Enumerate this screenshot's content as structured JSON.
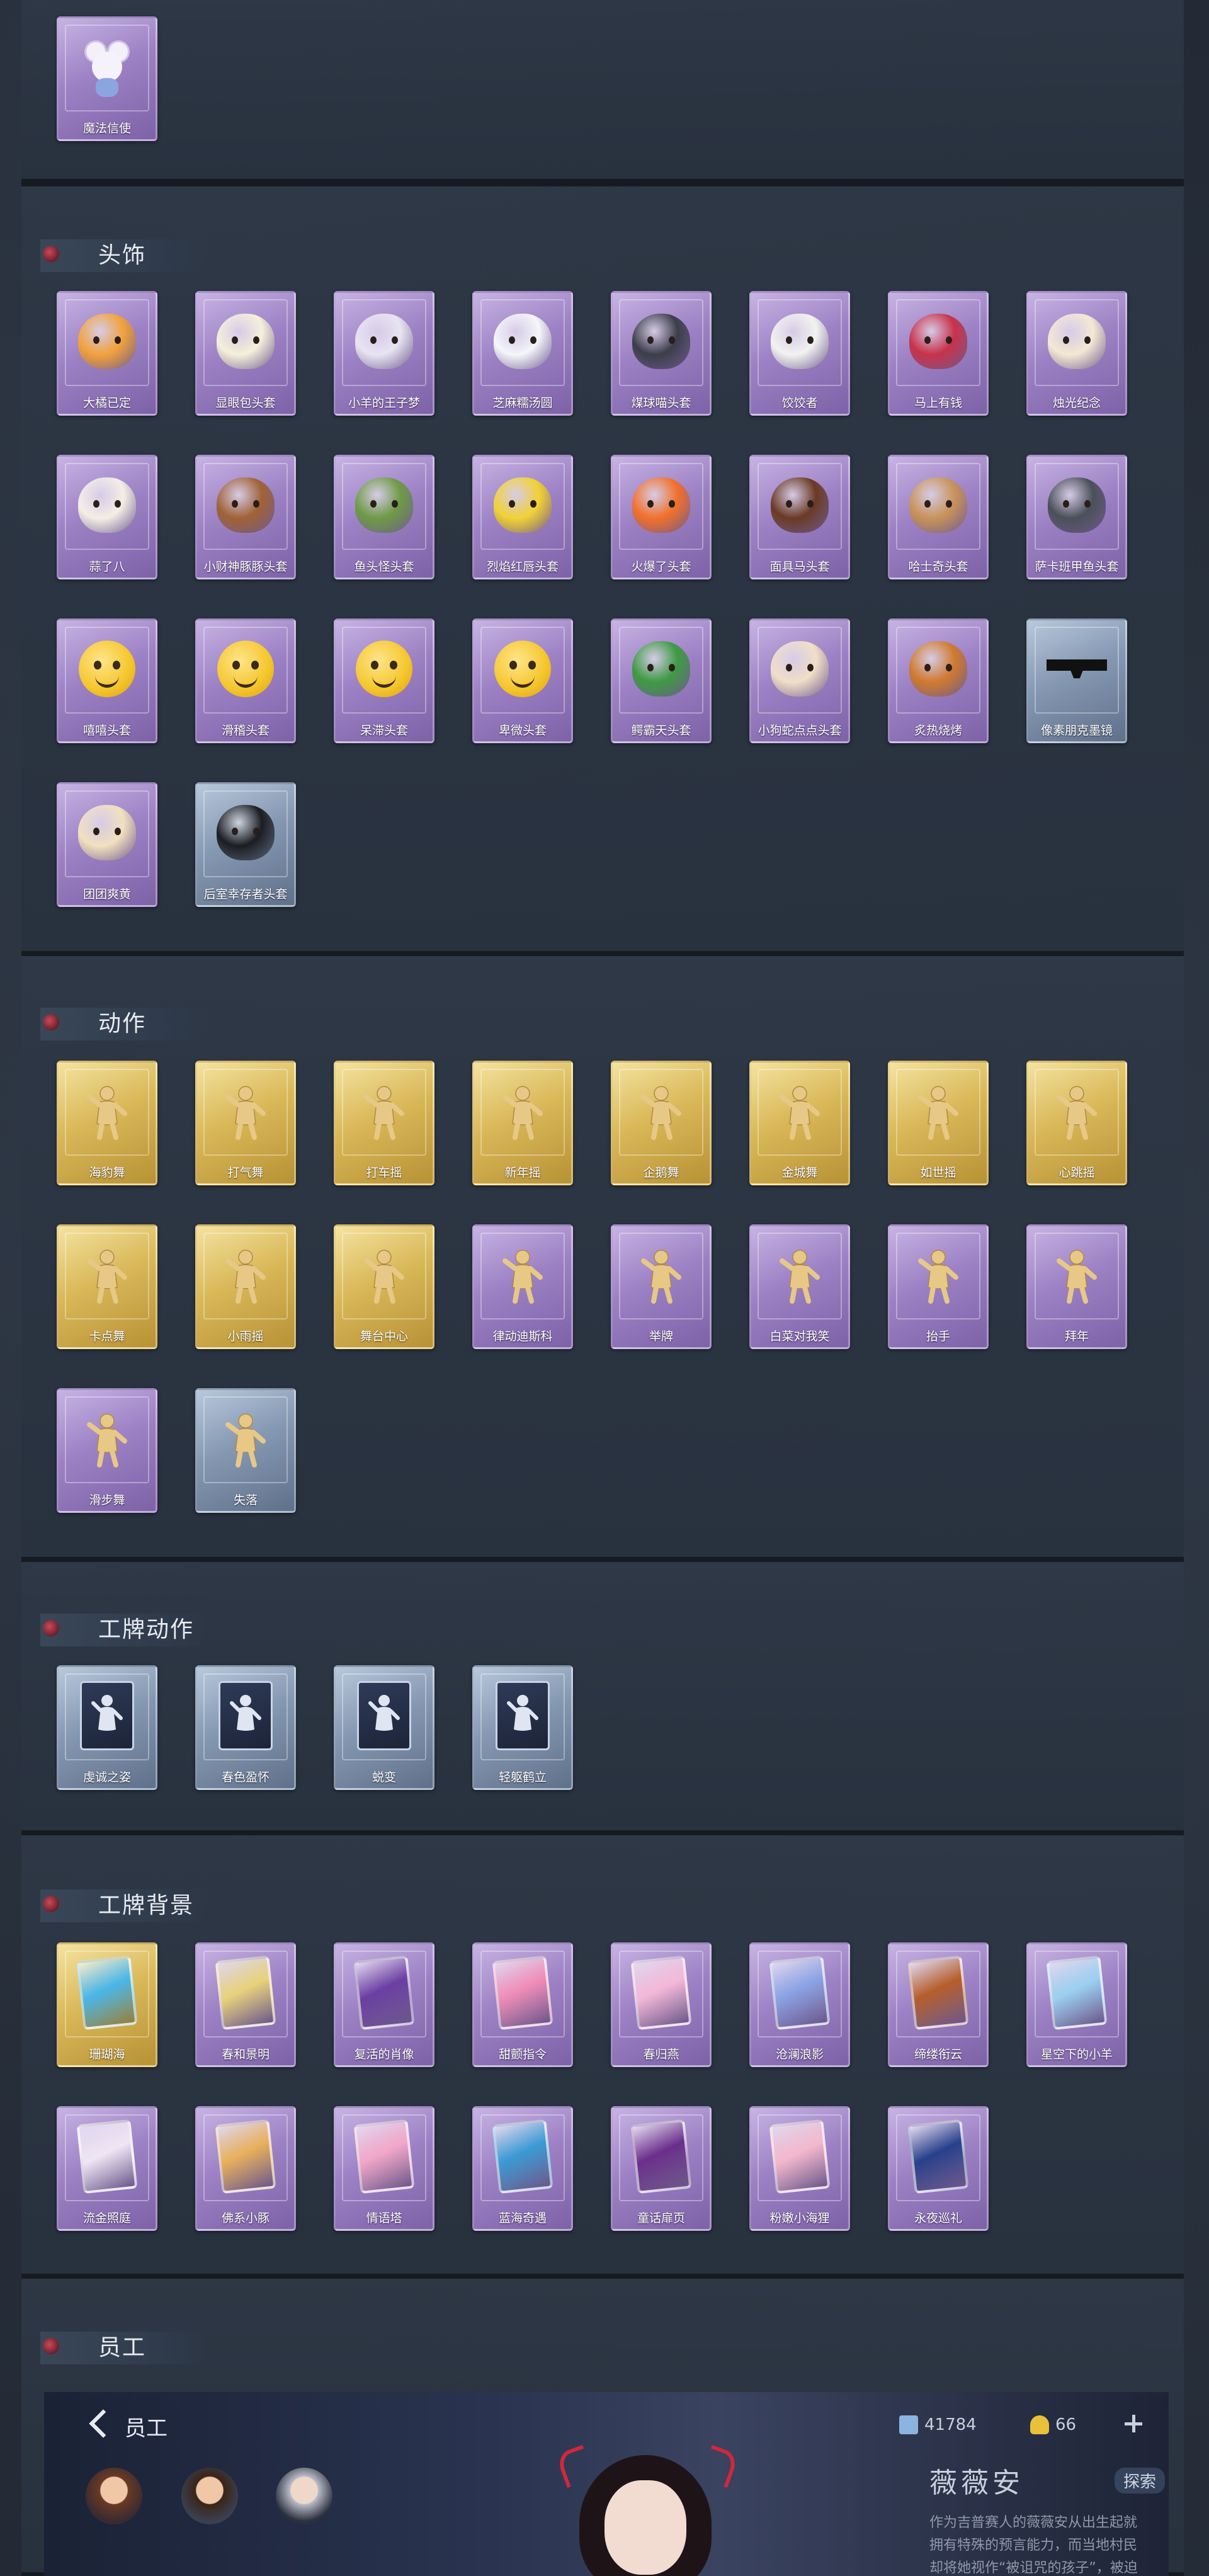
{
  "top_section": {
    "items": [
      {
        "label": "魔法信使",
        "style": "purple",
        "icon": "mouse-mascot-icon"
      }
    ]
  },
  "sections": [
    {
      "title": "头饰",
      "items": [
        {
          "label": "大橘已定",
          "style": "purple",
          "icon": "orange-head-icon",
          "color": "#f2a23c"
        },
        {
          "label": "显眼包头套",
          "style": "purple",
          "icon": "lightbulb-head-icon",
          "color": "#f5f0da"
        },
        {
          "label": "小羊的王子梦",
          "style": "purple",
          "icon": "sheep-crown-head-icon",
          "color": "#e8e4f2"
        },
        {
          "label": "芝麻糯汤圆",
          "style": "purple",
          "icon": "rice-ball-head-icon",
          "color": "#f4f6fa"
        },
        {
          "label": "煤球喵头套",
          "style": "purple",
          "icon": "black-cat-head-icon",
          "color": "#3b3e4a"
        },
        {
          "label": "饺饺者",
          "style": "purple",
          "icon": "dumpling-head-icon",
          "color": "#f1f3f0"
        },
        {
          "label": "马上有钱",
          "style": "purple",
          "icon": "red-horse-head-icon",
          "color": "#c8324a"
        },
        {
          "label": "烛光纪念",
          "style": "purple",
          "icon": "candle-head-icon",
          "color": "#f4e8d4"
        },
        {
          "label": "蒜了八",
          "style": "purple",
          "icon": "garlic-head-icon",
          "color": "#f3efe6"
        },
        {
          "label": "小财神豚豚头套",
          "style": "purple",
          "icon": "piggy-head-icon",
          "color": "#a06236"
        },
        {
          "label": "鱼头怪头套",
          "style": "purple",
          "icon": "fish-head-icon",
          "color": "#6e9a46"
        },
        {
          "label": "烈焰红唇头套",
          "style": "purple",
          "icon": "pikachu-head-icon",
          "color": "#f2d234"
        },
        {
          "label": "火爆了头套",
          "style": "purple",
          "icon": "flame-head-icon",
          "color": "#f2702a"
        },
        {
          "label": "面具马头套",
          "style": "purple",
          "icon": "horse-mask-icon",
          "color": "#6a3a24"
        },
        {
          "label": "哈士奇头套",
          "style": "purple",
          "icon": "husky-head-icon",
          "color": "#c8935a"
        },
        {
          "label": "萨卡班甲鱼头套",
          "style": "purple",
          "icon": "fish-blob-head-icon",
          "color": "#4a5058"
        },
        {
          "label": "嘻嘻头套",
          "style": "purple",
          "icon": "grin-emoji-icon",
          "color": "#f4c52a"
        },
        {
          "label": "滑稽头套",
          "style": "purple",
          "icon": "smirk-emoji-icon",
          "color": "#f4c52a"
        },
        {
          "label": "呆滞头套",
          "style": "purple",
          "icon": "dazed-emoji-icon",
          "color": "#f4c52a"
        },
        {
          "label": "卑微头套",
          "style": "purple",
          "icon": "humble-emoji-icon",
          "color": "#f4c52a"
        },
        {
          "label": "鳄霸天头套",
          "style": "purple",
          "icon": "crocodile-head-icon",
          "color": "#3e9a44"
        },
        {
          "label": "小狗蛇点点头套",
          "style": "purple",
          "icon": "snake-head-icon",
          "color": "#f1dfc7"
        },
        {
          "label": "炙热烧烤",
          "style": "purple",
          "icon": "bbq-head-icon",
          "color": "#d07a2e"
        },
        {
          "label": "像素朋克墨镜",
          "style": "blue",
          "icon": "pixel-sunglasses-icon",
          "color": "#111111"
        },
        {
          "label": "团团爽黄",
          "style": "purple",
          "icon": "hamster-head-icon",
          "color": "#f2e0bf"
        },
        {
          "label": "后室幸存者头套",
          "style": "blue",
          "icon": "helmet-head-icon",
          "color": "#1b1d22"
        }
      ]
    },
    {
      "title": "动作",
      "items": [
        {
          "label": "海豹舞",
          "style": "gold",
          "icon": "seal-dance-pose-icon"
        },
        {
          "label": "打气舞",
          "style": "gold",
          "icon": "cheer-dance-pose-icon"
        },
        {
          "label": "打车摇",
          "style": "gold",
          "icon": "taxi-shake-pose-icon"
        },
        {
          "label": "新年摇",
          "style": "gold",
          "icon": "new-year-shake-pose-icon"
        },
        {
          "label": "企鹅舞",
          "style": "gold",
          "icon": "penguin-dance-pose-icon"
        },
        {
          "label": "金城舞",
          "style": "gold",
          "icon": "golden-city-dance-pose-icon"
        },
        {
          "label": "如世摇",
          "style": "gold",
          "icon": "world-shake-pose-icon"
        },
        {
          "label": "心跳摇",
          "style": "gold",
          "icon": "heartbeat-shake-pose-icon"
        },
        {
          "label": "卡点舞",
          "style": "gold",
          "icon": "beat-dance-pose-icon"
        },
        {
          "label": "小雨摇",
          "style": "gold",
          "icon": "rain-shake-pose-icon"
        },
        {
          "label": "舞台中心",
          "style": "gold",
          "icon": "stage-center-pose-icon"
        },
        {
          "label": "律动迪斯科",
          "style": "purple",
          "icon": "disco-pose-icon"
        },
        {
          "label": "举牌",
          "style": "purple",
          "icon": "sign-raise-pose-icon"
        },
        {
          "label": "白菜对我笑",
          "style": "purple",
          "icon": "cabbage-smile-pose-icon"
        },
        {
          "label": "抬手",
          "style": "purple",
          "icon": "raise-hand-pose-icon"
        },
        {
          "label": "拜年",
          "style": "purple",
          "icon": "new-year-greeting-pose-icon"
        },
        {
          "label": "滑步舞",
          "style": "purple",
          "icon": "slide-dance-pose-icon"
        },
        {
          "label": "失落",
          "style": "blue",
          "icon": "crawl-dejected-pose-icon"
        }
      ]
    },
    {
      "title": "工牌动作",
      "items": [
        {
          "label": "虔诚之姿",
          "style": "blue",
          "icon": "badge-pose-pious-icon"
        },
        {
          "label": "春色盈怀",
          "style": "blue",
          "icon": "badge-pose-spring-icon"
        },
        {
          "label": "蜕变",
          "style": "blue",
          "icon": "badge-pose-transform-icon"
        },
        {
          "label": "轻躯鹤立",
          "style": "blue",
          "icon": "badge-pose-crane-icon"
        }
      ]
    },
    {
      "title": "工牌背景",
      "items": [
        {
          "label": "珊瑚海",
          "style": "gold",
          "icon": "badge-bg-coral-sea-icon",
          "color": "#48b6e8"
        },
        {
          "label": "春和景明",
          "style": "purple",
          "icon": "badge-bg-spring-icon",
          "color": "#e8d27a"
        },
        {
          "label": "复活的肖像",
          "style": "purple",
          "icon": "badge-bg-portrait-icon",
          "color": "#6a3ea2"
        },
        {
          "label": "甜颤指令",
          "style": "purple",
          "icon": "badge-bg-sweet-icon",
          "color": "#f08cb8"
        },
        {
          "label": "春归燕",
          "style": "purple",
          "icon": "badge-bg-swallow-icon",
          "color": "#f4b8d8"
        },
        {
          "label": "沧澜浪影",
          "style": "purple",
          "icon": "badge-bg-wave-icon",
          "color": "#8aa2e4"
        },
        {
          "label": "缔缕衔云",
          "style": "purple",
          "icon": "badge-bg-cloud-icon",
          "color": "#b65e2a"
        },
        {
          "label": "星空下的小羊",
          "style": "purple",
          "icon": "badge-bg-starry-sheep-icon",
          "color": "#9ad0f0"
        },
        {
          "label": "流金照庭",
          "style": "purple",
          "icon": "badge-bg-golden-court-icon",
          "color": "#efe6f4"
        },
        {
          "label": "佛系小豚",
          "style": "purple",
          "icon": "badge-bg-buddha-pig-icon",
          "color": "#e8b05a"
        },
        {
          "label": "情语塔",
          "style": "purple",
          "icon": "badge-bg-love-tower-icon",
          "color": "#f2a6c8"
        },
        {
          "label": "蓝海奇遇",
          "style": "purple",
          "icon": "badge-bg-blue-sea-icon",
          "color": "#3a9ad4"
        },
        {
          "label": "童话扉页",
          "style": "purple",
          "icon": "badge-bg-fairy-tale-icon",
          "color": "#6a2e8a"
        },
        {
          "label": "粉嫩小海狸",
          "style": "purple",
          "icon": "badge-bg-pink-beaver-icon",
          "color": "#f4b8cc"
        },
        {
          "label": "永夜巡礼",
          "style": "purple",
          "icon": "badge-bg-eternal-night-icon",
          "color": "#27408a"
        }
      ]
    },
    {
      "title": "员工",
      "items": []
    }
  ],
  "staff_screen": {
    "back_label": "员工",
    "resources": [
      {
        "value": "41784",
        "icon": "feather-currency-icon",
        "color": "#8cb4e0"
      },
      {
        "value": "66",
        "icon": "gold-ingot-icon",
        "color": "#e8c03a"
      }
    ],
    "character_name": "薇薇安",
    "explore_label": "探索",
    "description": "作为吉普赛人的薇薇安从出生起就拥有特殊的预言能力，而当地村民却将她视作“被诅咒的孩子”，被迫逃离家乡后她来到了庄园……"
  }
}
